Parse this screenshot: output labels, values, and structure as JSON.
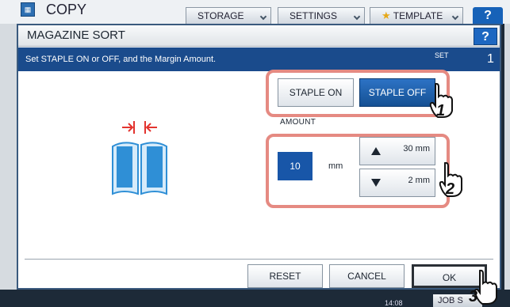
{
  "app": {
    "title": "COPY",
    "tabs": [
      {
        "label": "STORAGE"
      },
      {
        "label": "SETTINGS"
      },
      {
        "label": "TEMPLATE"
      }
    ],
    "help_label": "?",
    "time": "14:08",
    "job_label": "JOB S"
  },
  "dialog": {
    "title": "MAGAZINE SORT",
    "help_label": "?",
    "instruction": "Set STAPLE ON or OFF, and the Margin Amount.",
    "set_label": "SET",
    "set_number": "1"
  },
  "staple": {
    "on_label": "STAPLE ON",
    "off_label": "STAPLE OFF",
    "selected": "STAPLE OFF"
  },
  "amount": {
    "label": "AMOUNT",
    "value": "10",
    "unit": "mm",
    "up_limit": "30 mm",
    "down_limit": "2 mm"
  },
  "footer": {
    "reset_label": "RESET",
    "cancel_label": "CANCEL",
    "ok_label": "OK"
  },
  "steps": [
    "1",
    "2",
    "3"
  ],
  "colors": {
    "accent": "#1856a8",
    "highlight": "#e58a82",
    "book": "#2f8fd6",
    "margin_arrows": "#e3342f"
  },
  "icons": {
    "book": "book-margin-icon",
    "hand": "hand-pointer-icon",
    "up": "triangle-up-icon",
    "down": "triangle-down-icon",
    "chevron": "chevron-down-icon",
    "star": "star-icon"
  }
}
